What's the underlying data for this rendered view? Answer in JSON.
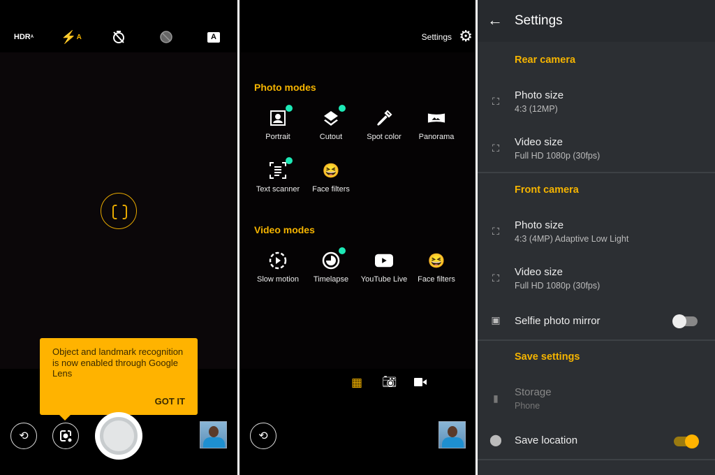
{
  "camera": {
    "top_icons": [
      "hdr-auto-icon",
      "flash-auto-icon",
      "timer-off-icon",
      "filter-off-icon",
      "auto-mode-icon"
    ],
    "hdr_label": "HDR",
    "tooltip": {
      "text": "Object and landmark recognition is now enabled through Google Lens",
      "action": "GOT IT"
    }
  },
  "modes": {
    "settings_label": "Settings",
    "photo_title": "Photo modes",
    "photo": [
      {
        "label": "Portrait",
        "new": true
      },
      {
        "label": "Cutout",
        "new": true
      },
      {
        "label": "Spot color",
        "new": false
      },
      {
        "label": "Panorama",
        "new": false
      },
      {
        "label": "Text scanner",
        "new": true
      },
      {
        "label": "Face filters",
        "new": false
      }
    ],
    "video_title": "Video modes",
    "video": [
      {
        "label": "Slow motion",
        "new": false
      },
      {
        "label": "Timelapse",
        "new": true
      },
      {
        "label": "YouTube Live",
        "new": false
      },
      {
        "label": "Face filters",
        "new": false
      }
    ]
  },
  "settings": {
    "title": "Settings",
    "rear": "Rear camera",
    "rear_photo": {
      "t": "Photo size",
      "s": "4:3 (12MP)"
    },
    "rear_video": {
      "t": "Video size",
      "s": "Full HD 1080p (30fps)"
    },
    "front": "Front camera",
    "front_photo": {
      "t": "Photo size",
      "s": "4:3 (4MP) Adaptive Low Light"
    },
    "front_video": {
      "t": "Video size",
      "s": "Full HD 1080p (30fps)"
    },
    "selfie": {
      "t": "Selfie photo mirror",
      "on": false
    },
    "save": "Save settings",
    "storage": {
      "t": "Storage",
      "s": "Phone",
      "disabled": true
    },
    "location": {
      "t": "Save location",
      "on": true
    }
  },
  "colors": {
    "accent": "#f5b400",
    "new_dot": "#1de9b6",
    "tooltip": "#ffb300"
  }
}
